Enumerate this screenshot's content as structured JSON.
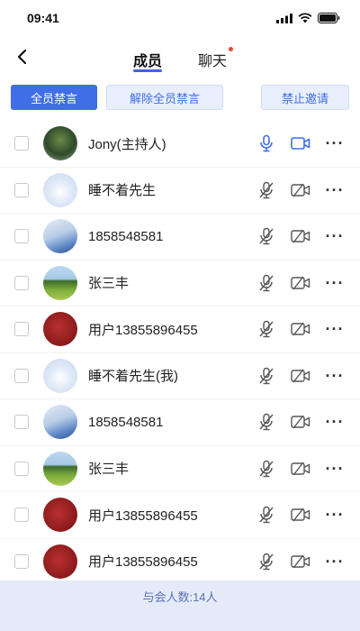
{
  "status_bar": {
    "time": "09:41"
  },
  "nav": {
    "tabs": [
      {
        "label": "成员",
        "active": true
      },
      {
        "label": "聊天",
        "has_dot": true
      }
    ]
  },
  "actions": {
    "mute_all": "全员禁言",
    "unmute_all": "解除全员禁言",
    "forbid_invite": "禁止邀请"
  },
  "members": [
    {
      "name": "Jony(主持人)",
      "avatar": "forest",
      "mic_on": true,
      "cam_on": true
    },
    {
      "name": "睡不着先生",
      "avatar": "cloud",
      "mic_on": false,
      "cam_on": false
    },
    {
      "name": "1858548581",
      "avatar": "girl",
      "mic_on": false,
      "cam_on": false
    },
    {
      "name": "张三丰",
      "avatar": "field",
      "mic_on": false,
      "cam_on": false
    },
    {
      "name": "用户13855896455",
      "avatar": "red",
      "mic_on": false,
      "cam_on": false
    },
    {
      "name": "睡不着先生(我)",
      "avatar": "cloud",
      "mic_on": false,
      "cam_on": false
    },
    {
      "name": "1858548581",
      "avatar": "girl",
      "mic_on": false,
      "cam_on": false
    },
    {
      "name": "张三丰",
      "avatar": "field",
      "mic_on": false,
      "cam_on": false
    },
    {
      "name": "用户13855896455",
      "avatar": "red",
      "mic_on": false,
      "cam_on": false
    },
    {
      "name": "用户13855896455",
      "avatar": "red",
      "mic_on": false,
      "cam_on": false
    }
  ],
  "footer": {
    "attendee_count": "与会人数:14人"
  },
  "colors": {
    "accent": "#3f6ee8",
    "footer_bg": "#e4eaf8",
    "dot": "#e64b3b"
  }
}
